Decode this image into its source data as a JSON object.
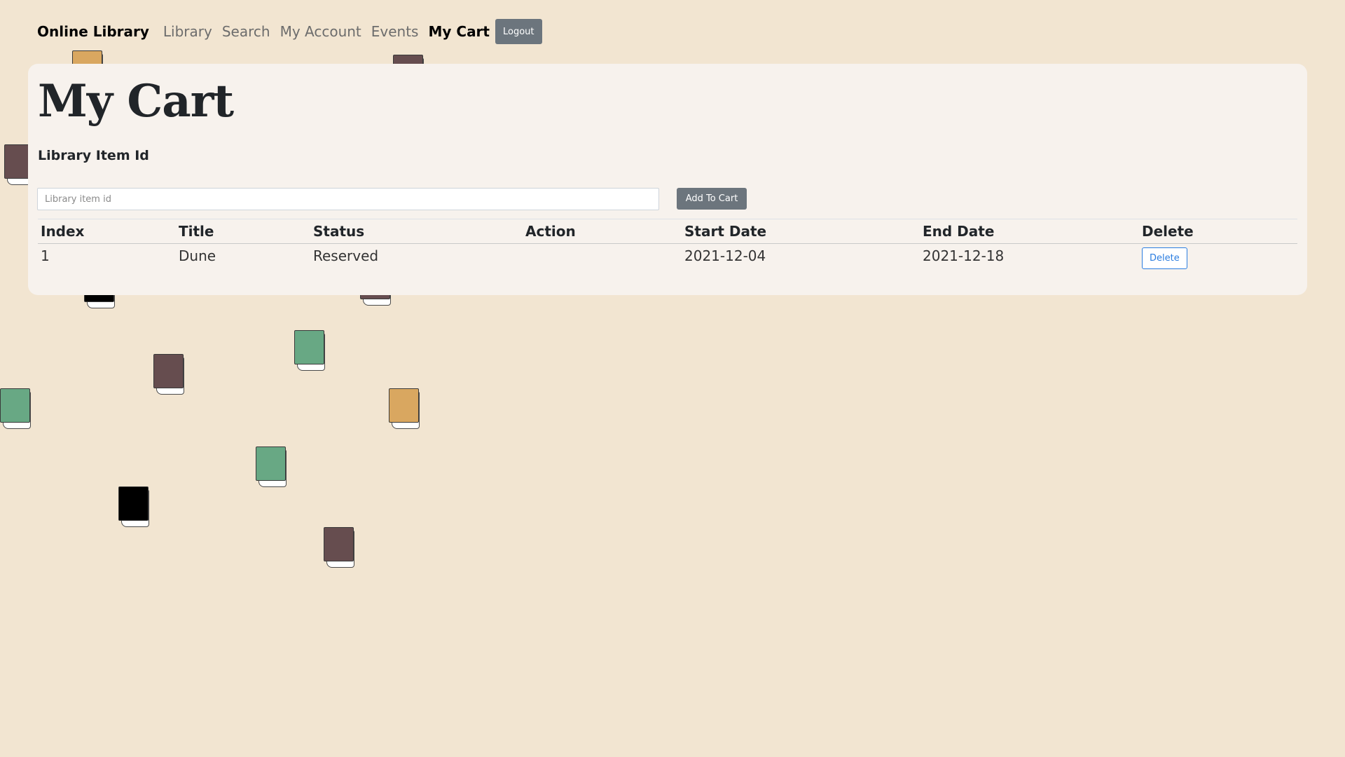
{
  "nav": {
    "brand": "Online Library",
    "links": [
      "Library",
      "Search",
      "My Account",
      "Events"
    ],
    "active": "My Cart",
    "logout_label": "Logout"
  },
  "page": {
    "title": "My Cart",
    "field_label": "Library Item Id",
    "input_placeholder": "Library item id",
    "input_value": "",
    "add_button_label": "Add To Cart"
  },
  "table": {
    "headers": [
      "Index",
      "Title",
      "Status",
      "Action",
      "Start Date",
      "End Date",
      "Delete"
    ],
    "rows": [
      {
        "index": "1",
        "title": "Dune",
        "status": "Reserved",
        "action": "",
        "start_date": "2021-12-04",
        "end_date": "2021-12-18",
        "delete_label": "Delete"
      }
    ]
  },
  "background": {
    "book_colors": {
      "brown": "#664d4f",
      "green": "#68a884",
      "orange": "#d9a760",
      "black": "#000000"
    }
  }
}
